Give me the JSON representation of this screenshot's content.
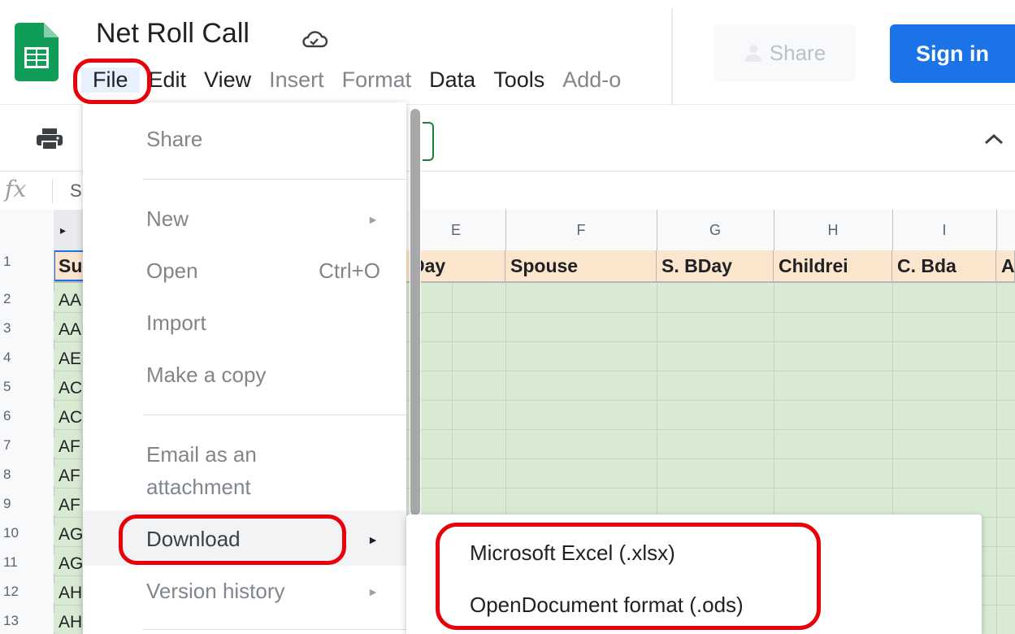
{
  "document": {
    "title": "Net Roll Call"
  },
  "icons": {
    "logo": "sheets-logo-icon",
    "cloud": "cloud-saved-icon",
    "print": "print-icon",
    "collapse": "chevron-up-icon",
    "share_person": "person-icon"
  },
  "colors": {
    "accent": "#1a73e8",
    "sheets_green": "#0f9d58",
    "highlight_red": "#e8000a",
    "header_row": "#fce5cd",
    "cell_fill": "#d9ead3"
  },
  "menubar": [
    {
      "label": "File",
      "disabled": false
    },
    {
      "label": "Edit",
      "disabled": false
    },
    {
      "label": "View",
      "disabled": false
    },
    {
      "label": "Insert",
      "disabled": true
    },
    {
      "label": "Format",
      "disabled": true
    },
    {
      "label": "Data",
      "disabled": false
    },
    {
      "label": "Tools",
      "disabled": false
    },
    {
      "label": "Add-o",
      "disabled": true
    }
  ],
  "header_buttons": {
    "share": "Share",
    "sign_in": "Sign in"
  },
  "formula_bar": {
    "fx": "fx",
    "value": "S"
  },
  "grid": {
    "columns": [
      "E",
      "F",
      "G",
      "H",
      "I"
    ],
    "header_row": [
      "Day",
      "Spouse",
      "S. BDay",
      "Childrei",
      "C. Bda",
      "A"
    ],
    "col_a_header": "Su",
    "row_numbers": [
      "1",
      "2",
      "3",
      "4",
      "5",
      "6",
      "7",
      "8",
      "9",
      "10",
      "11",
      "12",
      "13"
    ],
    "col_a_values": [
      "AA",
      "AA",
      "AE",
      "AC",
      "AC",
      "AF",
      "AF",
      "AF",
      "AG",
      "AG",
      "AH",
      "AH"
    ]
  },
  "file_menu": {
    "share": "Share",
    "new": "New",
    "open": "Open",
    "open_shortcut": "Ctrl+O",
    "import": "Import",
    "make_copy": "Make a copy",
    "email_line1": "Email as an",
    "email_line2": "attachment",
    "download": "Download",
    "version_history": "Version history"
  },
  "download_submenu": {
    "xlsx": "Microsoft Excel (.xlsx)",
    "ods": "OpenDocument format (.ods)"
  }
}
